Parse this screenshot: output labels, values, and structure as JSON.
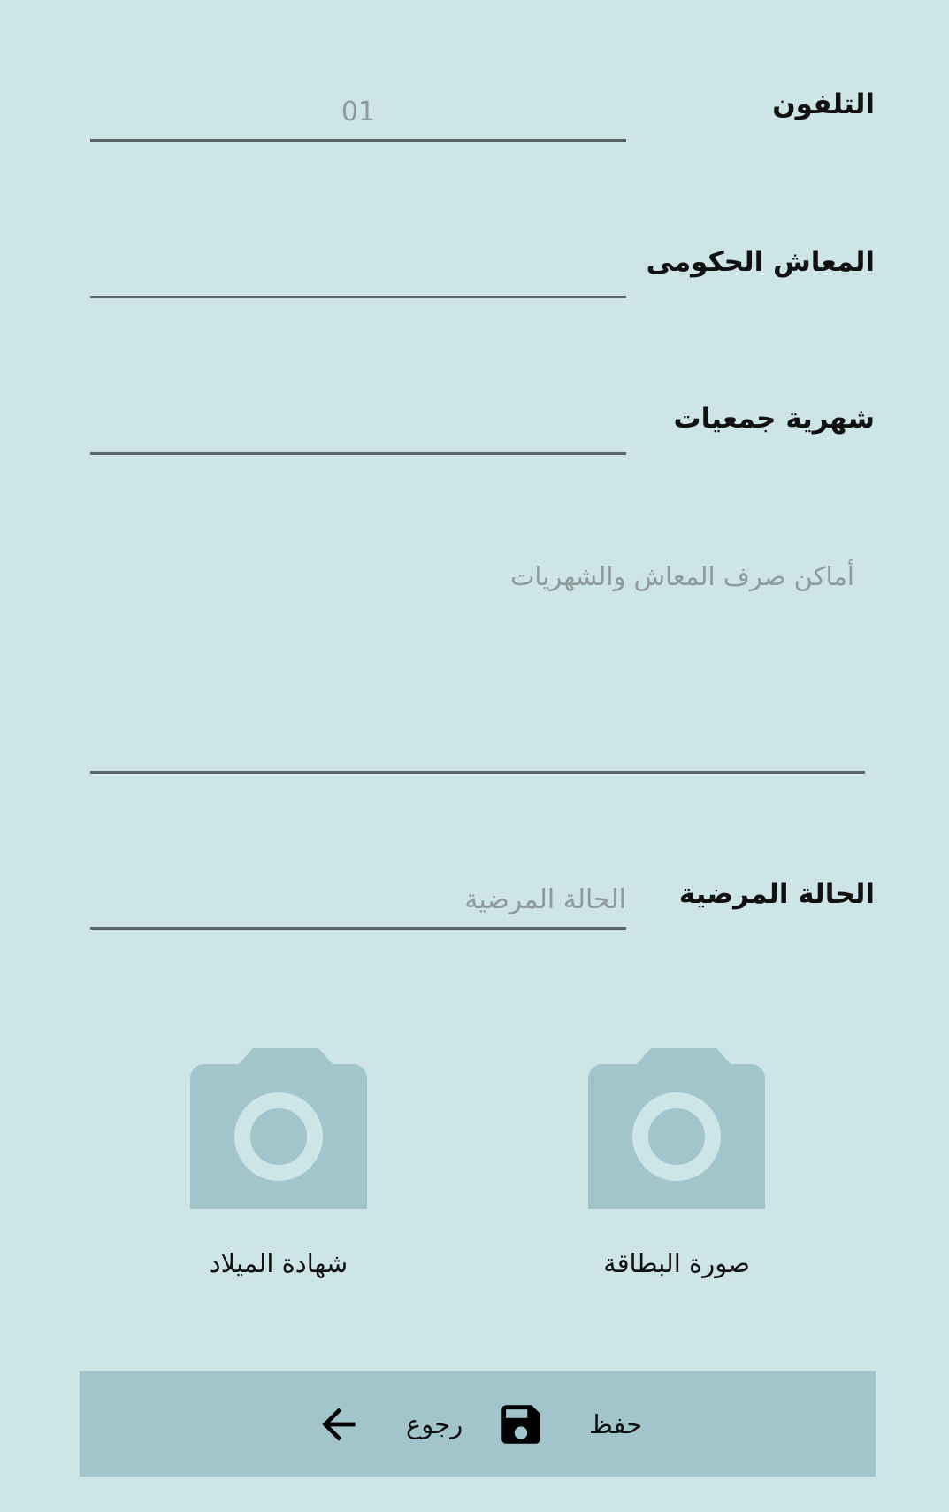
{
  "form": {
    "phone": {
      "label": "التلفون",
      "placeholder": "01",
      "value": ""
    },
    "gov_pension": {
      "label": "المعاش الحكومى",
      "value": ""
    },
    "assoc_monthly": {
      "label": "شهرية جمعيات",
      "value": ""
    },
    "payment_places": {
      "placeholder": "أماكن صرف المعاش والشهريات",
      "value": ""
    },
    "medical_status": {
      "label": "الحالة المرضية",
      "placeholder": "الحالة المرضية",
      "value": ""
    }
  },
  "photos": {
    "id_card_label": "صورة البطاقة",
    "birth_cert_label": "شهادة الميلاد"
  },
  "bottom_bar": {
    "save_label": "حفظ",
    "back_label": "رجوع"
  },
  "colors": {
    "background": "#cee5e7",
    "accent": "#a1c5cb",
    "underline": "#5c6566"
  },
  "icons": {
    "photo": "camera-icon",
    "save": "floppy-disk-icon",
    "back": "arrow-left-icon"
  }
}
